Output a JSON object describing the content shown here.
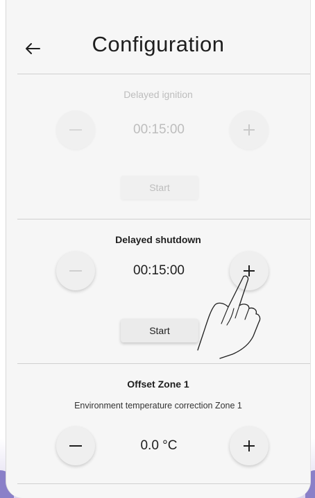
{
  "header": {
    "title": "Configuration",
    "back_icon": "arrow-left-icon"
  },
  "delayed_ignition": {
    "title": "Delayed ignition",
    "value": "00:15:00",
    "start_label": "Start",
    "enabled": false
  },
  "delayed_shutdown": {
    "title": "Delayed shutdown",
    "value": "00:15:00",
    "start_label": "Start",
    "enabled": true
  },
  "offset_zone_1": {
    "title": "Offset Zone 1",
    "subtitle": "Environment temperature correction Zone 1",
    "value": "0.0 °C",
    "enabled": true
  },
  "colors": {
    "background": "#f6f6f6",
    "text_dark": "#1e1e1e",
    "text_disabled": "#bdbdbd",
    "device_accent": "#8a80c8"
  }
}
